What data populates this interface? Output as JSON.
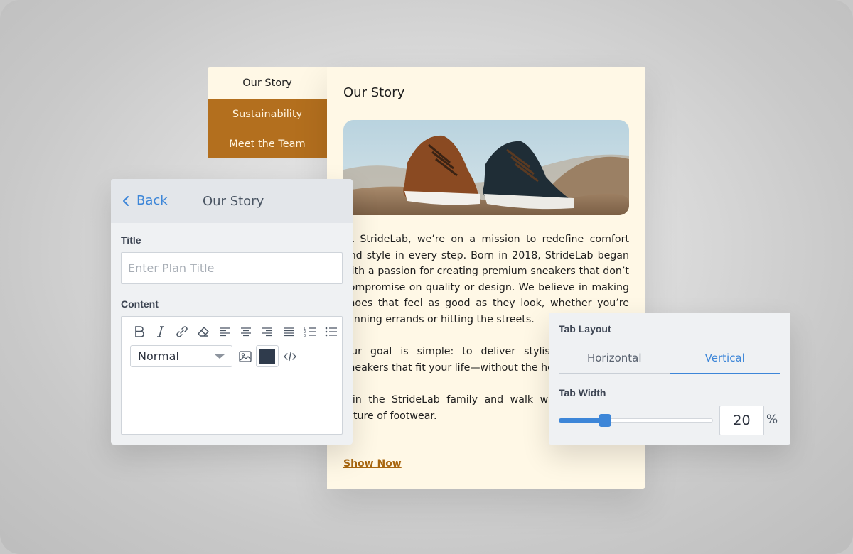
{
  "tabs": [
    {
      "label": "Our Story",
      "active": true
    },
    {
      "label": "Sustainability",
      "active": false
    },
    {
      "label": "Meet the Team",
      "active": false
    }
  ],
  "content": {
    "title": "Our Story",
    "paragraphs": [
      "At StrideLab, we’re on a mission to redefine comfort and style in every step. Born in 2018, StrideLab began with a passion for creating premium sneakers that don’t compromise on quality or design. We believe in making shoes that feel as good as they look, whether you’re running errands or hitting the streets.",
      "Our goal is simple: to deliver stylish, comfortable sneakers that fit your life—without the hefty price tag.",
      "Join the StrideLab family and walk with us into the future of footwear."
    ],
    "cta": "Show Now"
  },
  "editor": {
    "back_label": "Back",
    "title": "Our Story",
    "title_label": "Title",
    "title_placeholder": "Enter Plan Title",
    "title_value": "",
    "content_label": "Content",
    "text_style": "Normal",
    "text_color": "#2f3b4c"
  },
  "settings": {
    "layout_label": "Tab Layout",
    "layout_options": [
      "Horizontal",
      "Vertical"
    ],
    "layout_selected": "Vertical",
    "width_label": "Tab Width",
    "width_value": "20",
    "width_unit": "%",
    "slider_fraction": 0.3
  },
  "colors": {
    "accent": "#3d86d8",
    "tab_brown": "#b36f1e",
    "card_cream": "#fff8e6",
    "link_brown": "#a8660f"
  }
}
